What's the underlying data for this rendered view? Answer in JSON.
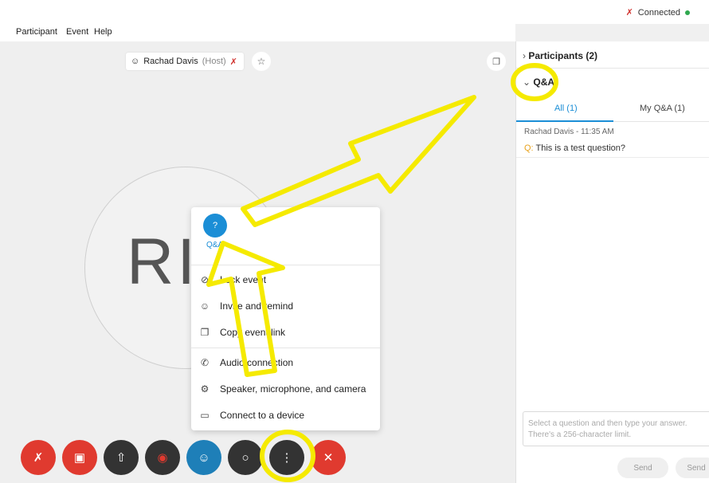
{
  "status": {
    "connected_text": "Connected"
  },
  "menu": [
    "Participant",
    "Event",
    "Help"
  ],
  "video": {
    "host_name": "Rachad Davis",
    "host_tag": "(Host)",
    "avatar_initials": "RI"
  },
  "more_menu": {
    "qa_label": "Q&A",
    "items": [
      {
        "icon": "lock-icon",
        "label": "Lock event"
      },
      {
        "icon": "invite-icon",
        "label": "Invite and remind"
      },
      {
        "icon": "copy-icon",
        "label": "Copy event link"
      },
      {
        "icon": "phone-icon",
        "label": "Audio connection"
      },
      {
        "icon": "settings-icon",
        "label": "Speaker, microphone, and camera"
      },
      {
        "icon": "cast-icon",
        "label": "Connect to a device"
      }
    ]
  },
  "panel": {
    "participants_header": "Participants (2)",
    "qa_header": "Q&A",
    "tabs": {
      "all": "All (1)",
      "my": "My Q&A (1)"
    },
    "question": {
      "author_time": "Rachad Davis - 11:35 AM",
      "prefix": "Q:",
      "text": "This is a test question?"
    },
    "input_placeholder_line1": "Select a question and then type your answer.",
    "input_placeholder_line2": "There's a 256-character limit.",
    "send_label": "Send",
    "send_all_label": "Send"
  },
  "colors": {
    "annotation_yellow": "#f5ea00",
    "accent_blue": "#1b8ed6",
    "end_red": "#e03a2f"
  }
}
